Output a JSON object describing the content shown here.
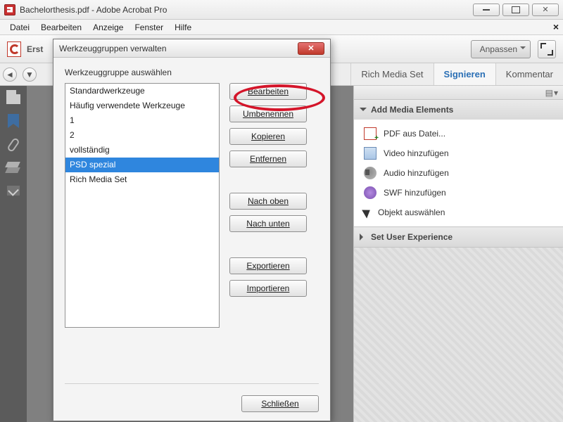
{
  "window": {
    "title": "Bachelorthesis.pdf - Adobe Acrobat Pro"
  },
  "menubar": [
    "Datei",
    "Bearbeiten",
    "Anzeige",
    "Fenster",
    "Hilfe"
  ],
  "toolbar": {
    "left_label": "Erst",
    "customize": "Anpassen"
  },
  "tabs": {
    "rich_media": "Rich Media Set",
    "sign": "Signieren",
    "comment": "Kommentar"
  },
  "right_panel": {
    "section1": {
      "title": "Add Media Elements"
    },
    "items": [
      "PDF aus Datei...",
      "Video hinzufügen",
      "Audio hinzufügen",
      "SWF hinzufügen",
      "Objekt auswählen"
    ],
    "section2": {
      "title": "Set User Experience"
    }
  },
  "dialog": {
    "title": "Werkzeuggruppen verwalten",
    "label": "Werkzeuggruppe auswählen",
    "list": [
      "Standardwerkzeuge",
      "Häufig verwendete Werkzeuge",
      "1",
      "2",
      "vollständig",
      "PSD spezial",
      "Rich Media Set"
    ],
    "selected_index": 5,
    "buttons": {
      "edit": "Bearbeiten",
      "rename": "Umbenennen",
      "copy": "Kopieren",
      "remove": "Entfernen",
      "up": "Nach oben",
      "down": "Nach unten",
      "export": "Exportieren",
      "import": "Importieren",
      "close": "Schließen"
    }
  }
}
